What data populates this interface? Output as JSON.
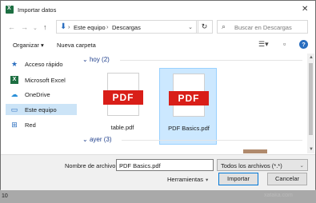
{
  "window": {
    "title": "Importar datos",
    "close_icon": "close-icon"
  },
  "nav": {
    "address": [
      "Este equipo",
      "Descargas"
    ],
    "search_placeholder": "Buscar en Descargas"
  },
  "command_bar": {
    "organize": "Organizar",
    "new_folder": "Nueva carpeta"
  },
  "sidebar": {
    "items": [
      {
        "label": "Acceso rápido",
        "icon": "star-icon",
        "color": "#2a6ebf"
      },
      {
        "label": "Microsoft Excel",
        "icon": "excel-icon",
        "color": "#1d6f42"
      },
      {
        "label": "OneDrive",
        "icon": "cloud-icon",
        "color": "#2a8fd8"
      },
      {
        "label": "Este equipo",
        "icon": "computer-icon",
        "color": "#2a6ebf",
        "selected": true
      },
      {
        "label": "Red",
        "icon": "network-icon",
        "color": "#2a6ebf"
      }
    ]
  },
  "content": {
    "groups": [
      {
        "label": "hoy (2)"
      },
      {
        "label": "ayer (3)"
      }
    ],
    "files": [
      {
        "name": "table.pdf",
        "badge": "PDF",
        "selected": false
      },
      {
        "name": "PDF Basics.pdf",
        "badge": "PDF",
        "selected": true
      }
    ]
  },
  "bottom": {
    "filename_label": "Nombre de archivo:",
    "filename_value": "PDF Basics.pdf",
    "filter_value": "Todos los archivos (*.*)",
    "tools_label": "Herramientas",
    "import_label": "Importar",
    "cancel_label": "Cancelar"
  },
  "background": {
    "row_number": "10",
    "watermark": "xataka.com"
  }
}
